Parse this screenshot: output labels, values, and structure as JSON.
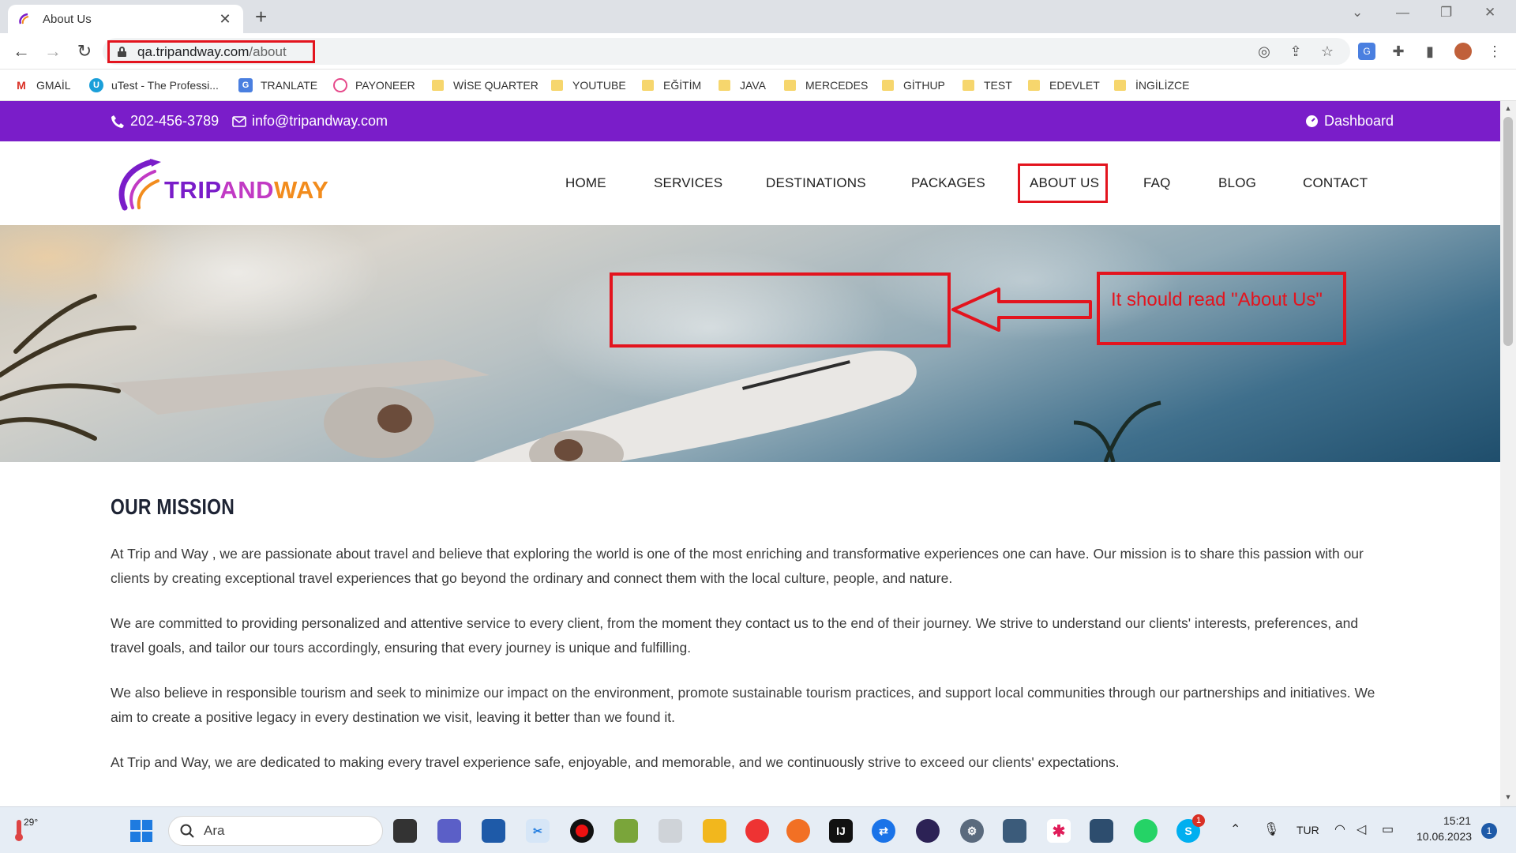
{
  "browser": {
    "tab_title": "About Us",
    "tab_close": "✕",
    "new_tab": "+",
    "url_host": "qa.tripandway.com",
    "url_path": "/about",
    "window_controls": [
      "⌄",
      "—",
      "❐",
      "✕"
    ],
    "bookmarks": [
      {
        "label": "GMAİL",
        "icon": "gmail-icon"
      },
      {
        "label": "uTest - The Professi...",
        "icon": "utest-icon"
      },
      {
        "label": "TRANLATE",
        "icon": "translate-icon"
      },
      {
        "label": "PAYONEER",
        "icon": "payoneer-icon"
      },
      {
        "label": "WİSE QUARTER",
        "icon": "folder-icon"
      },
      {
        "label": "YOUTUBE",
        "icon": "folder-icon"
      },
      {
        "label": "EĞİTİM",
        "icon": "folder-icon"
      },
      {
        "label": "JAVA",
        "icon": "folder-icon"
      },
      {
        "label": "MERCEDES",
        "icon": "folder-icon"
      },
      {
        "label": "GİTHUP",
        "icon": "folder-icon"
      },
      {
        "label": "TEST",
        "icon": "folder-icon"
      },
      {
        "label": "EDEVLET",
        "icon": "folder-icon"
      },
      {
        "label": "İNGİLİZCE",
        "icon": "folder-icon"
      }
    ]
  },
  "topbar": {
    "phone": "202-456-3789",
    "email": "info@tripandway.com",
    "dashboard": "Dashboard",
    "background": "#7a1dc9"
  },
  "logo": {
    "part1": "TRIP",
    "part2": "AND",
    "part3": "WAY"
  },
  "menu": [
    "HOME",
    "SERVICES",
    "DESTINATIONS",
    "PACKAGES",
    "ABOUT US",
    "FAQ",
    "BLOG",
    "CONTACT"
  ],
  "hero": {
    "annotation": "It should read \"About Us\"",
    "annotation_color": "#e3141e"
  },
  "mission": {
    "title": "OUR MISSION",
    "paragraphs": [
      "At Trip and Way , we are passionate about travel and believe that exploring the world is one of the most enriching and transformative experiences one can have. Our mission is to share this passion with our clients by creating exceptional travel experiences that go beyond the ordinary and connect them with the local culture, people, and nature.",
      "We are committed to providing personalized and attentive service to every client, from the moment they contact us to the end of their journey. We strive to understand our clients' interests, preferences, and travel goals, and tailor our tours accordingly, ensuring that every journey is unique and fulfilling.",
      "We also believe in responsible tourism and seek to minimize our impact on the environment, promote sustainable tourism practices, and support local communities through our partnerships and initiatives. We aim to create a positive legacy in every destination we visit, leaving it better than we found it.",
      "At Trip and Way, we are dedicated to making every travel experience safe, enjoyable, and memorable, and we continuously strive to exceed our clients' expectations."
    ]
  },
  "taskbar": {
    "weather": "29°",
    "search_placeholder": "Ara",
    "language": "TUR",
    "time": "15:21",
    "date": "10.06.2023",
    "notification_count": "1",
    "skype_badge": "1"
  }
}
